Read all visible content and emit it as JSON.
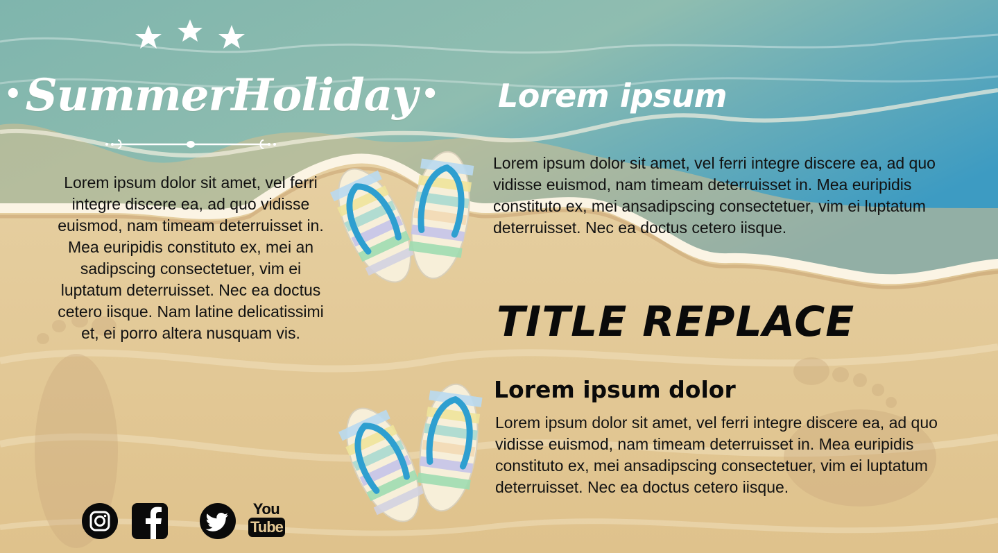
{
  "brand": {
    "title_part1": "Summer",
    "title_part2": "Holiday",
    "title_dot": "•"
  },
  "left_paragraph": "Lorem ipsum dolor sit amet, vel ferri integre discere ea, ad quo vidisse euismod, nam timeam deterruisset in. Mea euripidis constituto ex, mei an sadipscing consectetuer, vim ei luptatum deterruisset. Nec ea doctus cetero iisque. Nam latine delicatissimi et, ei porro altera nusquam vis.",
  "right_top": {
    "heading": "Lorem ipsum",
    "paragraph": "Lorem ipsum dolor sit amet, vel ferri integre discere ea, ad quo vidisse euismod, nam timeam deterruisset in. Mea euripidis constituto ex, mei ansadipscing consectetuer, vim ei luptatum deterruisset. Nec ea doctus cetero iisque."
  },
  "right_bottom": {
    "title": "TITLE REPLACE",
    "heading": "Lorem ipsum dolor",
    "paragraph": "Lorem ipsum dolor sit amet, vel ferri integre discere ea, ad quo vidisse euismod, nam timeam deterruisset in. Mea euripidis constituto ex, mei ansadipscing consectetuer, vim ei luptatum deterruisset. Nec ea doctus cetero iisque."
  },
  "social": {
    "youtube_top": "You",
    "youtube_bottom": "Tube",
    "icons": [
      "instagram-icon",
      "facebook-icon",
      "twitter-icon",
      "youtube-icon"
    ]
  },
  "colors": {
    "sea_top": "#3f9cc0",
    "sea_mid": "#7eb8b8",
    "sand": "#e4c894",
    "sand_light": "#ecdab5",
    "foam": "#fbf4e4",
    "text_dark": "#111111",
    "flipflop_strap": "#2e9fd0"
  }
}
